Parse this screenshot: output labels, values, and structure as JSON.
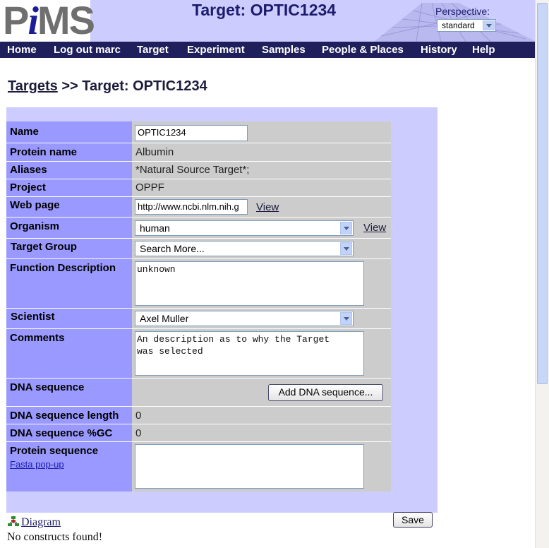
{
  "header": {
    "logo_text": "PiMS",
    "title": "Target: OPTIC1234",
    "perspective_label": "Perspective:",
    "perspective_value": "standard"
  },
  "menu": [
    {
      "label": "Home"
    },
    {
      "label": "Log out marc"
    },
    {
      "label": "Target"
    },
    {
      "label": "Experiment"
    },
    {
      "label": "Samples"
    },
    {
      "label": "People & Places"
    },
    {
      "label": "History"
    },
    {
      "label": "Help"
    }
  ],
  "breadcrumb": {
    "parent": "Targets",
    "separator": ">>",
    "current": "Target: OPTIC1234"
  },
  "form": {
    "name": {
      "label": "Name",
      "value": "OPTIC1234"
    },
    "protein_name": {
      "label": "Protein name",
      "value": "Albumin"
    },
    "aliases": {
      "label": "Aliases",
      "value": "*Natural Source Target*;"
    },
    "project": {
      "label": "Project",
      "value": "OPPF"
    },
    "web_page": {
      "label": "Web page",
      "value": "http://www.ncbi.nlm.nih.g",
      "link": "View"
    },
    "organism": {
      "label": "Organism",
      "value": "human",
      "link": "View"
    },
    "target_group": {
      "label": "Target Group",
      "value": "Search More..."
    },
    "function_description": {
      "label": "Function Description",
      "value": "unknown"
    },
    "scientist": {
      "label": "Scientist",
      "value": "Axel Muller"
    },
    "comments": {
      "label": "Comments",
      "value": "An description as to why the Target\nwas selected"
    },
    "dna_sequence": {
      "label": "DNA sequence",
      "button": "Add DNA sequence..."
    },
    "dna_length": {
      "label": "DNA sequence length",
      "value": "0"
    },
    "dna_gc": {
      "label": "DNA sequence %GC",
      "value": "0"
    },
    "protein_sequence": {
      "label": "Protein sequence",
      "fasta_link": "Fasta pop-up",
      "value": ""
    }
  },
  "actions": {
    "save": "Save"
  },
  "footer": {
    "diagram_link": "Diagram",
    "status": "No constructs found!"
  },
  "colors": {
    "header_bg": "#ccccff",
    "menubar_bg": "#1f1f5c",
    "label_column": "#9999ff",
    "data_column": "#cccccc",
    "panel_bg": "#ccccff"
  }
}
